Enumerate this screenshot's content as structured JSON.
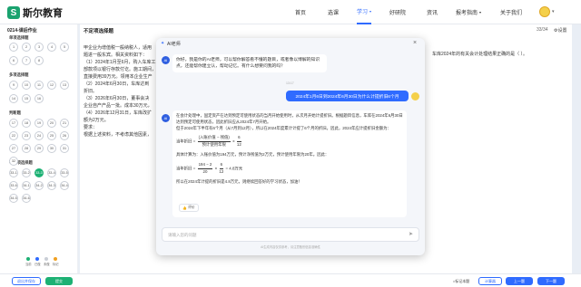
{
  "brand": {
    "logo_mark": "S",
    "name": "斯尔教育"
  },
  "nav": {
    "items": [
      "首页",
      "选课",
      "学习",
      "好研院",
      "资讯",
      "报考指南",
      "关于我们"
    ],
    "active": "学习"
  },
  "left_panel": {
    "title": "0214-课后作业",
    "sections": [
      {
        "label": "单项选择题",
        "numbers": [
          "1",
          "2",
          "3",
          "4",
          "5",
          "6",
          "7",
          "8"
        ]
      },
      {
        "label": "多项选择题",
        "numbers": [
          "9",
          "10",
          "11",
          "12",
          "13",
          "14",
          "15",
          "16"
        ]
      },
      {
        "label": "判断题",
        "numbers": [
          "17",
          "18",
          "19",
          "20",
          "21",
          "22",
          "23",
          "24",
          "25",
          "26",
          "27",
          "28",
          "29",
          "30",
          "31",
          "32"
        ]
      },
      {
        "label": "不定项选择题",
        "numbers": [
          "33-1",
          "33-2",
          "33-3",
          "33-4",
          "33-5",
          "33-6",
          "34-1",
          "34-2",
          "34-3",
          "34-4",
          "34-5",
          "34-6"
        ]
      }
    ],
    "current": "33-3",
    "legend": [
      {
        "label": "当前",
        "color": "#1db174"
      },
      {
        "label": "已做",
        "color": "#2f6bff"
      },
      {
        "label": "未做",
        "color": "#c9ced6"
      },
      {
        "label": "标记",
        "color": "#f0a020"
      }
    ]
  },
  "question": {
    "type_label": "不定项选择题",
    "count": "33/34",
    "settings": "设置",
    "lines": [
      "甲企业为增值税一般纳税人，适用",
      "题进一般东宾。相关资料如下：",
      "（1）2024年1月至6月，购入车库工",
      "部款项以银行存款付讫。施工期间，",
      "直接费用39万元。领用本企业生产",
      "（2）2024年6月30日，车库达到",
      "折旧。",
      "（3）2026年6月30日，董事会决",
      "企业自产产品一批。成本30万元，",
      "（4）2026年12月31日，车库改扩",
      "额为2万元。",
      "要求：",
      "根据上述资料，不考虑其他因素，"
    ],
    "tail": "车库2024年的有关会计处理结果正确的是（    ）。"
  },
  "bottom_bar": {
    "save_exit": "退出并保存",
    "submit": "提交",
    "mark": "标记本题",
    "calculator": "计算器",
    "prev": "上一题",
    "next": "下一题"
  },
  "ai_chat": {
    "title": "AI老师",
    "greeting": "你好，我是你的AI老师，可以帮你解答看不懂的题目，或者像以博解的知识点，还能帮你建立认，帮动记忆。有什么想要问我的吗？",
    "timestamp": "13:17",
    "user_question": "2024年1月6日到2024年6月30日为什么计提折旧6个月",
    "answer": {
      "intro": "在会计处理中，固定资产在达到预定可使用状态的当月开始使用时，从次月开始计提折旧。根据题目信息，车库在2024年6月30日达到预定可使用状态，因此折旧应从2024年7月开始。",
      "intro2": "但于2024年下半年有6个月（从7月到12月），所以在2024年度累计计提了6个月的折旧。因此，2024年应计提折旧金额为：",
      "formula1_lhs": "当年折旧 = ",
      "formula1_num": "(入账价值 − 残值)",
      "formula1_den": "预计使用年限",
      "formula1_mid": " × ",
      "formula1_num2": "6",
      "formula1_den2": "12",
      "calc_intro": "具体计算为：入账价值为194万元，预计净残值为2万元，预计使用年限为20年。因此：",
      "formula2_lhs": "当年折旧 = ",
      "formula2_num": "194 − 2",
      "formula2_den": "20",
      "formula2_mid": " × ",
      "formula2_num2": "6",
      "formula2_den2": "12",
      "formula2_result": " = 4.8万元",
      "conclusion": "所以在2024年计提的折旧是4.8万元，则继续回答好的学习状态，加油！"
    },
    "rate_label": "评价",
    "input_placeholder": "请输入您的问题",
    "disclaimer": "AI生成内容仅供参考，请注意甄别信息准确性"
  }
}
